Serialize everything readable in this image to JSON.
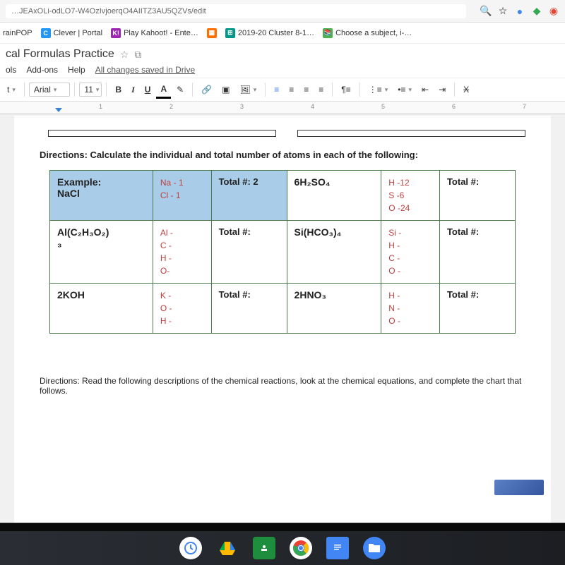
{
  "browser": {
    "url_fragment": "…JEAxOLi-odLO7-W4OzIvjoerqO4AIITZ3AU5QZVs/edit",
    "icons": {
      "search": "search-icon",
      "star": "star-icon"
    }
  },
  "bookmarks": [
    {
      "label": "rainPOP"
    },
    {
      "label": "Clever | Portal"
    },
    {
      "label": "Play Kahoot! - Ente…"
    },
    {
      "label": ""
    },
    {
      "label": "2019-20 Cluster 8-1…"
    },
    {
      "label": "Choose a subject, i-…"
    }
  ],
  "doc": {
    "title": "cal Formulas Practice",
    "menus": [
      "ols",
      "Add-ons",
      "Help"
    ],
    "saved": "All changes saved in Drive"
  },
  "toolbar": {
    "style": "t",
    "font": "Arial",
    "size": "11",
    "bold": "B",
    "italic": "I",
    "underline": "U",
    "textcolor": "A"
  },
  "ruler": {
    "marks": [
      "1",
      "2",
      "3",
      "4",
      "5",
      "6",
      "7"
    ]
  },
  "content": {
    "directions": "Directions: Calculate the individual and total number of atoms in each of the following:",
    "table": {
      "rows": [
        {
          "left_formula": "Example:\nNaCl",
          "left_breakdown": "Na - 1\nCl - 1",
          "left_total": "Total #: 2",
          "right_formula": "6H₂SO₄",
          "right_breakdown": "H -12\nS -6\nO -24",
          "right_total": "Total #:"
        },
        {
          "left_formula": "Al(C₂H₃O₂)\n    ₃",
          "left_breakdown": "Al -\nC -\nH -\nO-",
          "left_total": "Total #:",
          "right_formula": "Si(HCO₃)₄",
          "right_breakdown": "Si -\nH -\nC -\nO -",
          "right_total": "Total #:"
        },
        {
          "left_formula": "2KOH",
          "left_breakdown": "K -\nO -\nH -",
          "left_total": "Total #:",
          "right_formula": "2HNO₃",
          "right_breakdown": "H -\nN -\nO -",
          "right_total": "Total #:"
        }
      ]
    },
    "directions2": "Directions: Read the following descriptions of the chemical reactions, look at the chemical equations, and complete the chart that follows."
  },
  "taskbar": {
    "apps": [
      "clock",
      "drive",
      "classroom",
      "chrome",
      "docs",
      "files"
    ]
  }
}
